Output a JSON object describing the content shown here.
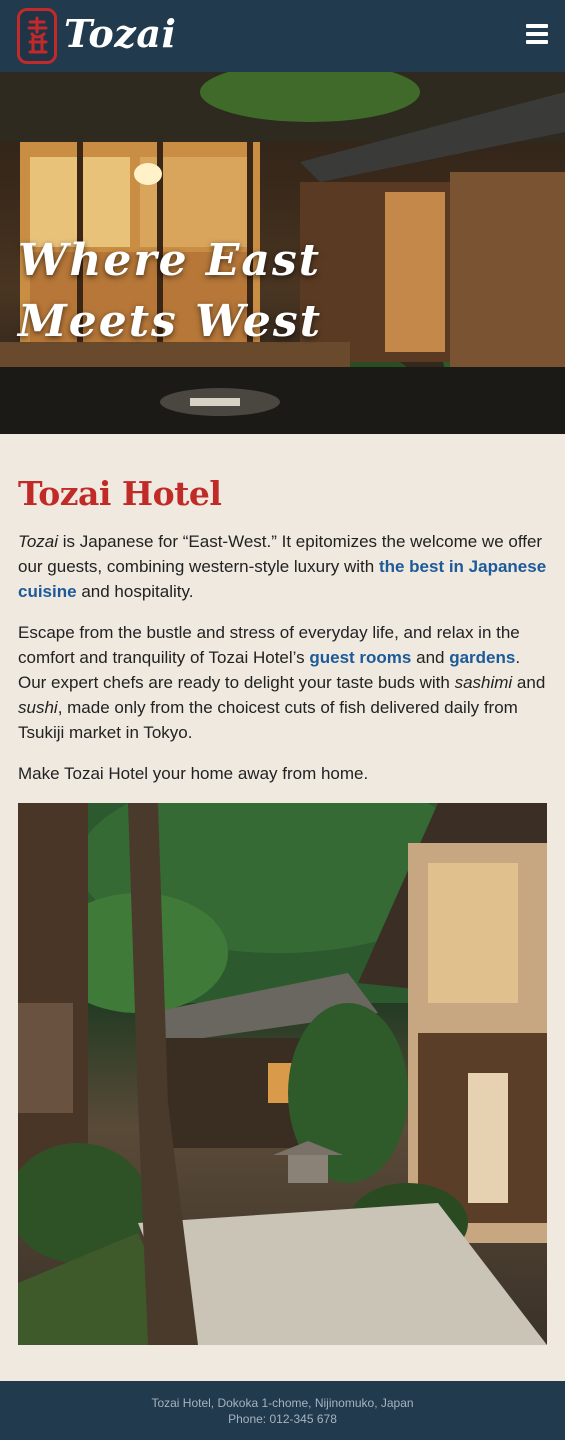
{
  "header": {
    "brand": "Tozai",
    "logo_icon": "tozai-kanji-logo",
    "menu_icon": "hamburger-menu-icon"
  },
  "hero": {
    "title": "Where East Meets West",
    "image": "ryokan-veranda-evening-photo"
  },
  "main": {
    "heading": "Tozai Hotel",
    "p1": {
      "em": "Tozai",
      "text1": " is Japanese for “East-West.” It epitomizes the welcome we offer our guests, combining western-style luxury with ",
      "link": "the best in Japanese cuisine",
      "text2": " and hospitality."
    },
    "p2": {
      "text1": "Escape from the bustle and stress of everyday life, and relax in the comfort and tranquility of Tozai Hotel’s ",
      "link1": "guest rooms",
      "text2": " and ",
      "link2": "gardens",
      "text3": ". Our expert chefs are ready to delight your taste buds with ",
      "em1": "sashimi",
      "text4": " and ",
      "em2": "sushi",
      "text5": ", made only from the choicest cuts of fish delivered daily from Tsukiji market in Tokyo."
    },
    "p3": "Make Tozai Hotel your home away from home.",
    "image": "japanese-garden-courtyard-photo"
  },
  "footer": {
    "address": "Tozai Hotel, Dokoka 1-chome, Nijinomuko, Japan",
    "phone": "Phone: 012-345 678"
  },
  "colors": {
    "header_bg": "#223a4d",
    "page_bg": "#efe9e0",
    "heading_red": "#c02a27",
    "link_blue": "#1d5a99"
  }
}
